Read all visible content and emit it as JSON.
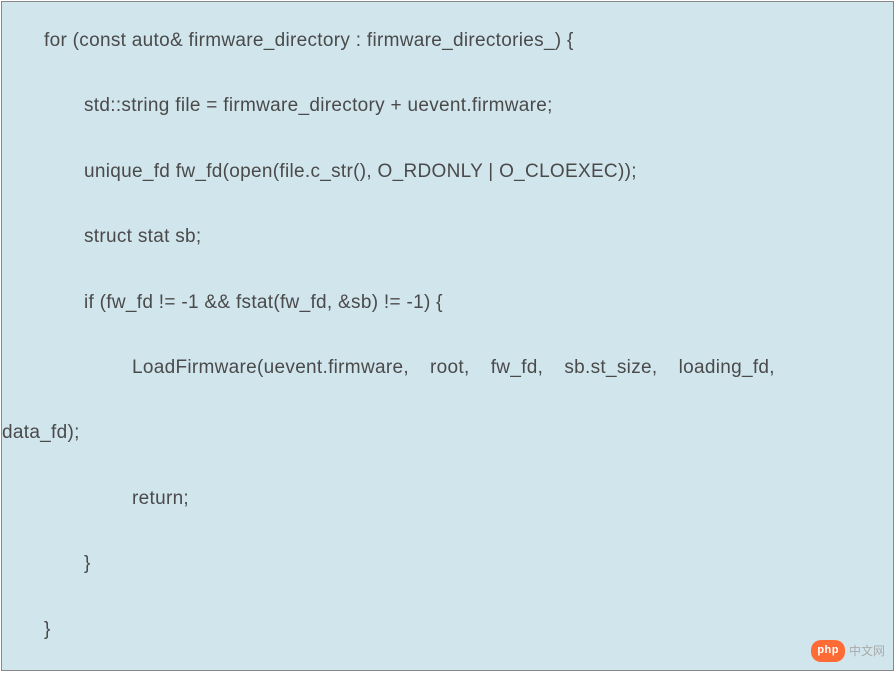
{
  "code": {
    "line1": "for (const auto& firmware_directory : firmware_directories_) {",
    "line2": "std::string file = firmware_directory + uevent.firmware;",
    "line3": "unique_fd fw_fd(open(file.c_str(), O_RDONLY | O_CLOEXEC));",
    "line4": "struct stat sb;",
    "line5": "if (fw_fd != -1 && fstat(fw_fd, &sb) != -1) {",
    "line6": "LoadFirmware(uevent.firmware,  root,  fw_fd,  sb.st_size,  loading_fd,",
    "line7": "data_fd);",
    "line8": "return;",
    "line9": "}",
    "line10": "}"
  },
  "watermark": {
    "badge": "php",
    "text": "中文网"
  }
}
